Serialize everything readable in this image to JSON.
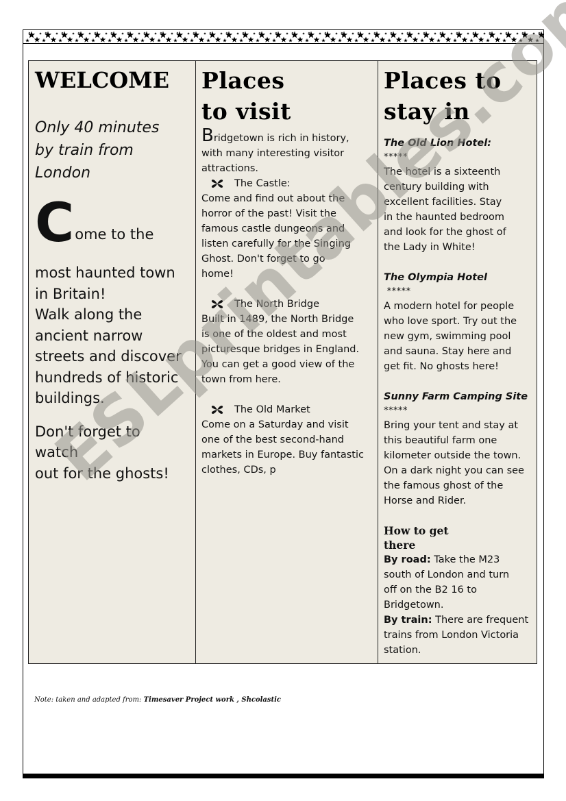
{
  "columns": {
    "welcome": {
      "heading": "WELCOME",
      "intro_lines": [
        "Only 40 minutes",
        "by train from",
        "London"
      ],
      "dropcap": "C",
      "dropcap_rest": "ome to the",
      "body_lines": [
        "most haunted town",
        "in Britain!",
        "Walk along the",
        "ancient narrow",
        "streets and discover",
        "hundreds of historic",
        "buildings."
      ],
      "closing_lines": [
        "Don't forget to",
        "watch",
        "out for the ghosts!"
      ]
    },
    "visit": {
      "heading_lines": [
        "Places",
        "to visit"
      ],
      "intro_cap": "B",
      "intro_rest": "ridgetown is rich in history,",
      "intro_lines": [
        "with many interesting visitor",
        "attractions."
      ],
      "bullet_icon": "butterfly-icon",
      "places": [
        {
          "name": "The Castle:",
          "lines": [
            "Come and find out about the",
            "horror of the past! Visit the",
            "famous castle dungeons and",
            "listen carefully for the Singing",
            "Ghost. Don't forget to go",
            "home!"
          ]
        },
        {
          "name": "The North Bridge",
          "lines": [
            "Built in 1489, the North Bridge",
            "is one of the oldest and most",
            "picturesque bridges in England.",
            "You can get a good view of the",
            "town from here."
          ]
        },
        {
          "name": "The Old Market",
          "lines": [
            "Come on a Saturday and visit",
            "one of the best second-hand",
            "markets in Europe. Buy fantastic",
            "clothes, CDs, p"
          ]
        }
      ]
    },
    "stay": {
      "heading_lines": [
        "Places to",
        "stay in"
      ],
      "hotels": [
        {
          "name": "The Old Lion Hotel:",
          "rating": "*****",
          "lines": [
            "The hotel is a sixteenth",
            "century building with",
            "excellent facilities. Stay",
            "in the haunted bedroom",
            "and look for the ghost of",
            "the Lady in White!"
          ]
        },
        {
          "name": "The Olympia Hotel",
          "rating": " *****",
          "lines": [
            "A modern hotel for people",
            "who love sport. Try out the",
            "new gym, swimming pool",
            "and sauna. Stay here and",
            "get fit. No ghosts here!"
          ]
        },
        {
          "name": "Sunny Farm Camping Site",
          "rating": "*****",
          "lines": [
            "Bring your tent and stay at",
            "this beautiful farm one",
            "kilometer outside the town.",
            "On a dark night you can see",
            "the famous ghost of the",
            "Horse and Rider."
          ]
        }
      ],
      "how_heading_lines": [
        "How to get",
        "there"
      ],
      "road_label": "By road:",
      "road_lines": [
        " Take the M23",
        "south of London and turn",
        "off on the B2 16 to",
        "Bridgetown."
      ],
      "train_label": "By train:",
      "train_lines": [
        " There are frequent",
        "trains from London Victoria",
        "station."
      ]
    }
  },
  "note": {
    "prefix": "Note: taken and adapted from: ",
    "source": "Timesaver Project work , Shcolastic"
  },
  "watermark": "ESLprintables.com",
  "colors": {
    "panel_bg": "#eeebe2",
    "watermark": "#96948c"
  }
}
